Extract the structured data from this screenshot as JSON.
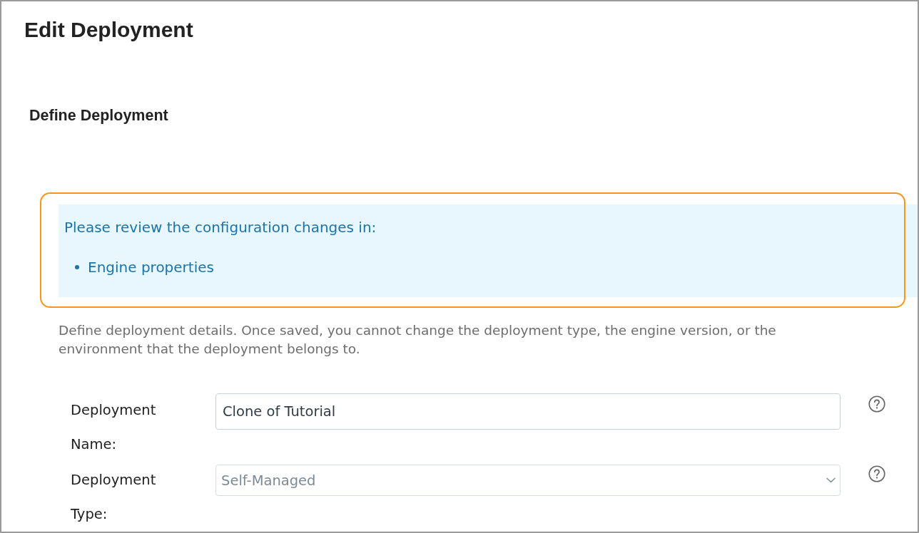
{
  "page": {
    "title": "Edit Deployment"
  },
  "section": {
    "title": "Define Deployment"
  },
  "notice": {
    "highlighted": true,
    "message": "Please review the configuration changes in:",
    "items": [
      "Engine properties"
    ]
  },
  "description": "Define deployment details. Once saved, you cannot change the deployment type, the engine version, or the environment that the deployment belongs to.",
  "form": {
    "fields": [
      {
        "kind": "text",
        "label": "Deployment Name:",
        "value": "Clone of Tutorial",
        "disabled": false,
        "help": true
      },
      {
        "kind": "select",
        "label": "Deployment Type:",
        "value": "Self-Managed",
        "disabled": true,
        "help": true
      }
    ]
  }
}
